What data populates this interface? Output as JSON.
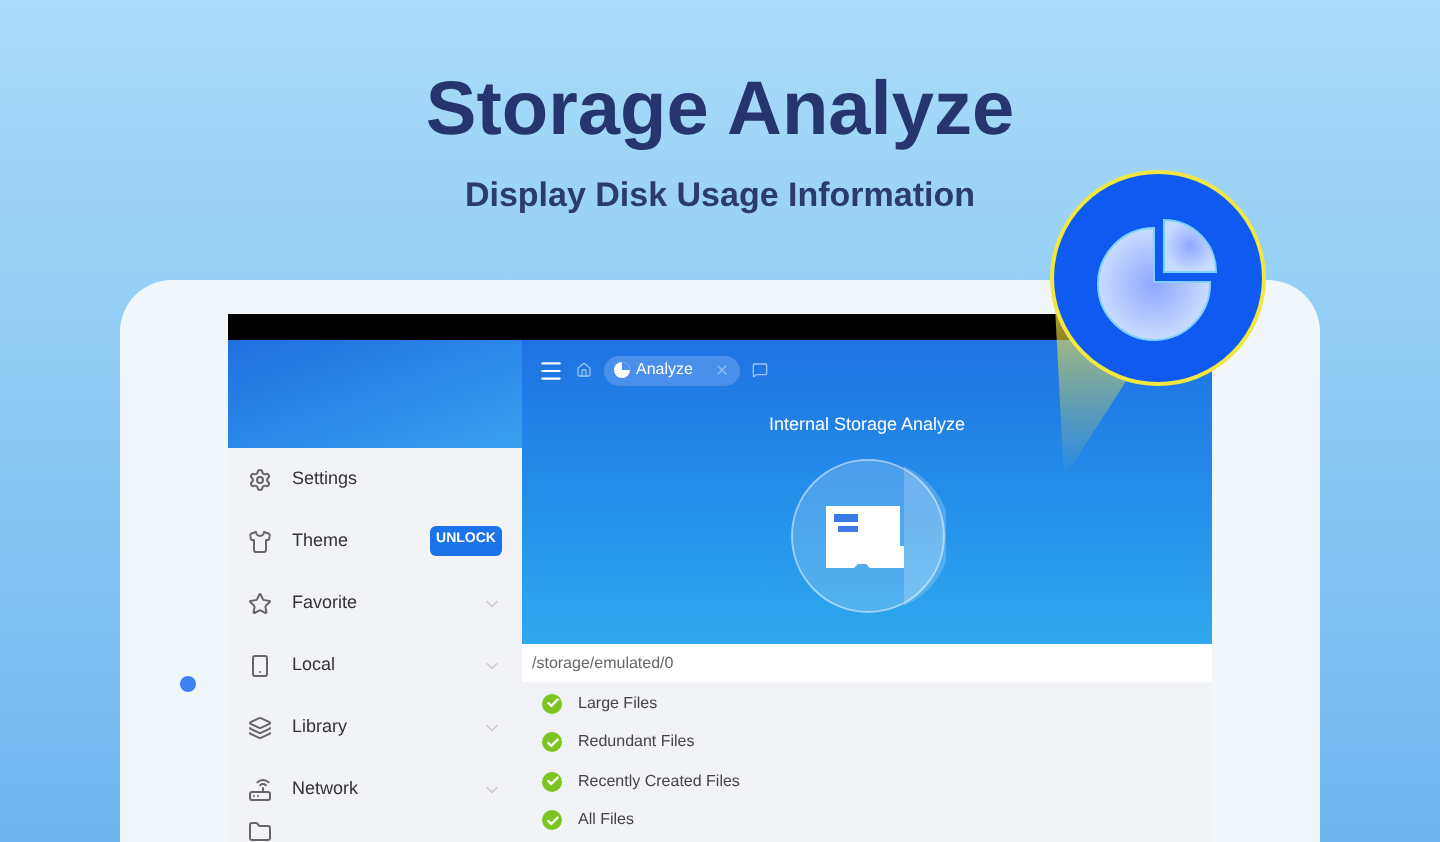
{
  "headline": {
    "title": "Storage Analyze",
    "subtitle": "Display Disk Usage Information"
  },
  "sidebar": {
    "items": [
      {
        "kind": "settings",
        "label": "Settings"
      },
      {
        "kind": "theme",
        "label": "Theme",
        "badge": "UNLOCK"
      },
      {
        "kind": "favorite",
        "label": "Favorite",
        "expandable": true
      },
      {
        "kind": "local",
        "label": "Local",
        "expandable": true
      },
      {
        "kind": "library",
        "label": "Library",
        "expandable": true
      },
      {
        "kind": "network",
        "label": "Network",
        "expandable": true
      }
    ]
  },
  "toolbar": {
    "tab": {
      "label": "Analyze"
    }
  },
  "analyzer": {
    "title": "Internal Storage Analyze",
    "path": "/storage/emulated/0"
  },
  "options": [
    {
      "label": "Large Files",
      "checked": true
    },
    {
      "label": "Redundant Files",
      "checked": true
    },
    {
      "label": "Recently Created Files",
      "checked": true
    },
    {
      "label": "All Files",
      "checked": true
    }
  ]
}
